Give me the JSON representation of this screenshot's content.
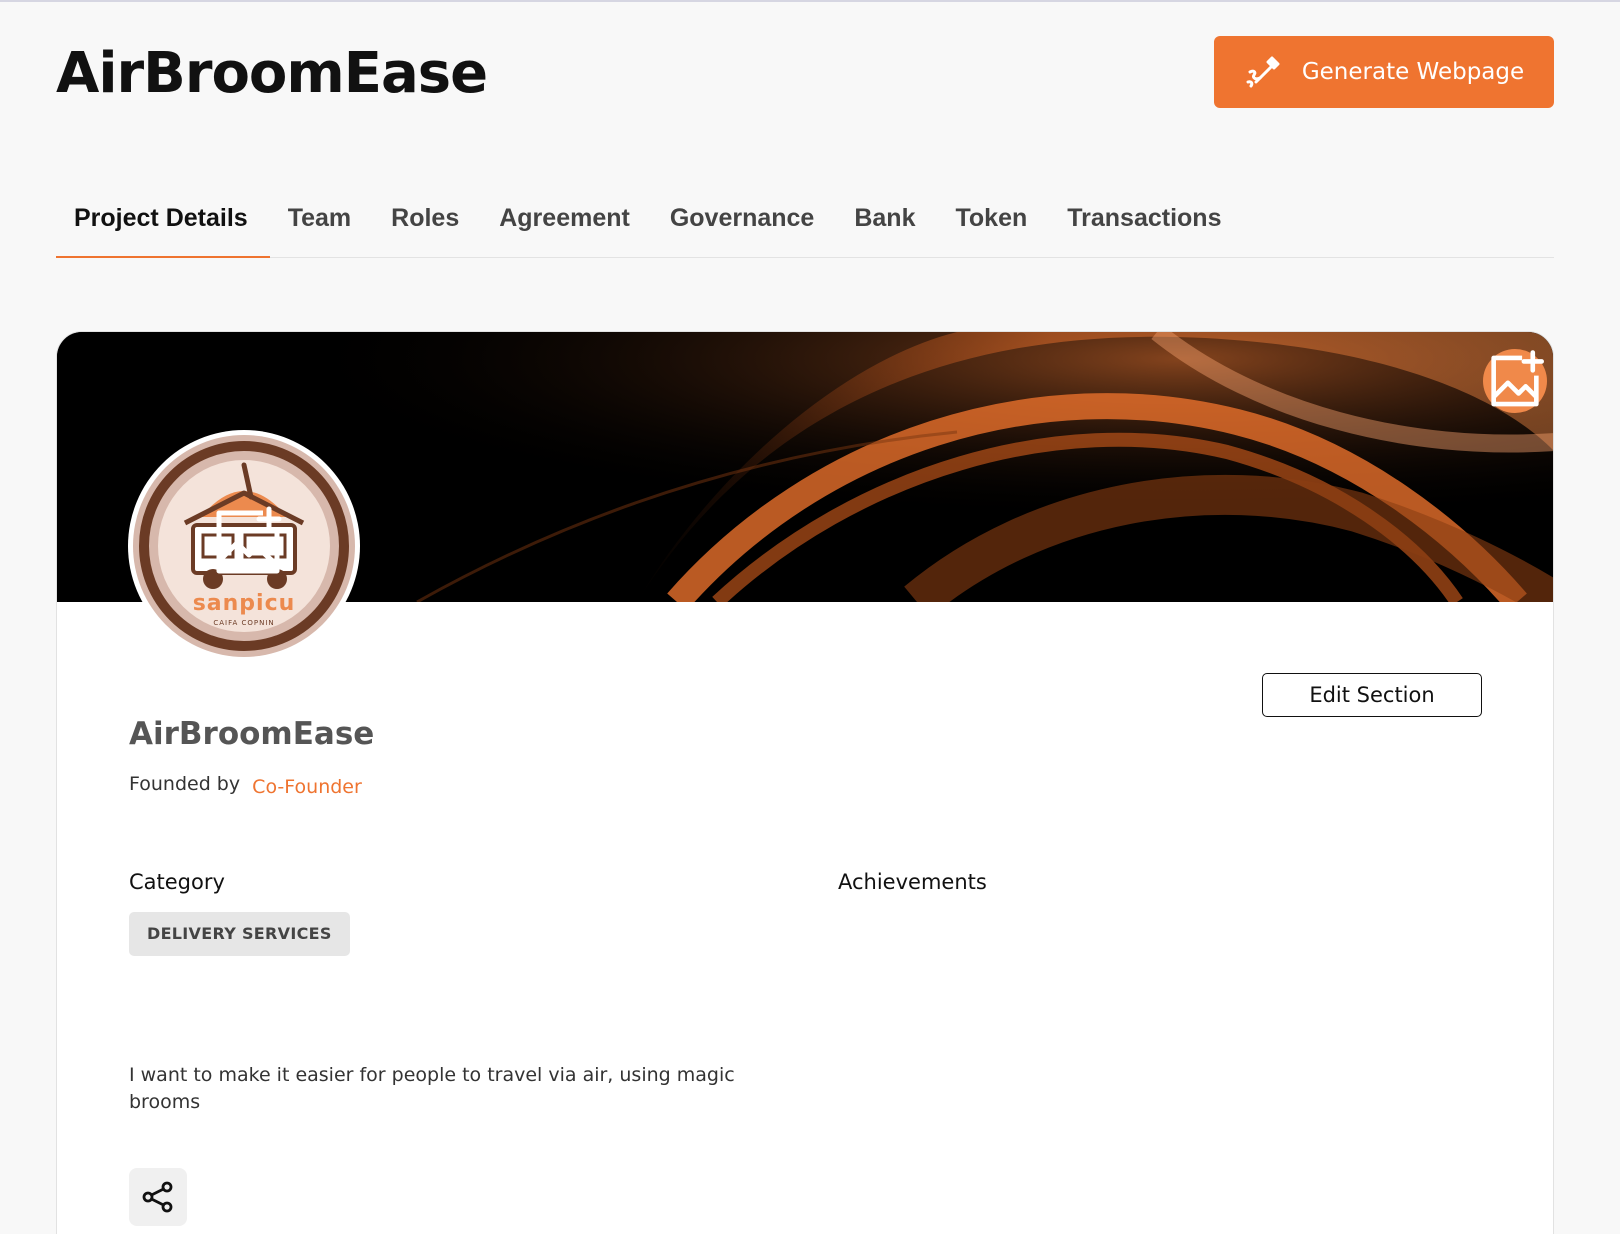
{
  "header": {
    "title": "AirBroomEase",
    "generate_button": "Generate Webpage"
  },
  "tabs": [
    {
      "label": "Project Details",
      "active": true
    },
    {
      "label": "Team"
    },
    {
      "label": "Roles"
    },
    {
      "label": "Agreement"
    },
    {
      "label": "Governance"
    },
    {
      "label": "Bank"
    },
    {
      "label": "Token"
    },
    {
      "label": "Transactions"
    }
  ],
  "project": {
    "avatar_brand": "sanpicu",
    "avatar_tagline": "CAIFA COPNIN",
    "edit_button": "Edit Section",
    "name": "AirBroomEase",
    "founded_label": "Founded by",
    "founder": "Co-Founder",
    "category_label": "Category",
    "category_value": "DELIVERY SERVICES",
    "achievements_label": "Achievements",
    "description": "I want to make it easier for people to travel via air, using magic brooms"
  },
  "colors": {
    "accent": "#ef7430",
    "banner_bg": "#000000",
    "avatar_bg": "#d7b8ac",
    "avatar_ring": "#6b3b25"
  },
  "icons": {
    "generate": "magic-wand-icon",
    "banner_upload": "add-image-icon",
    "avatar_upload": "add-image-icon",
    "share": "share-icon"
  }
}
